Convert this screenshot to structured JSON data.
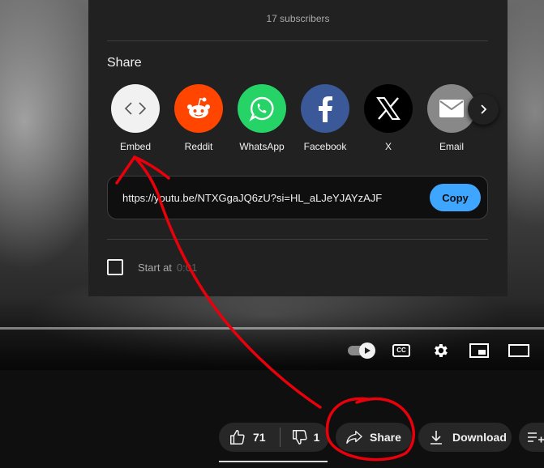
{
  "channel": {
    "subscribers": "17 subscribers"
  },
  "share_dialog": {
    "title": "Share",
    "targets": [
      {
        "label": "Embed",
        "icon": "embed-code-icon",
        "color": "#f1f1f1"
      },
      {
        "label": "Reddit",
        "icon": "reddit-icon",
        "color": "#ff4500"
      },
      {
        "label": "WhatsApp",
        "icon": "whatsapp-icon",
        "color": "#25d366"
      },
      {
        "label": "Facebook",
        "icon": "facebook-icon",
        "color": "#3b5998"
      },
      {
        "label": "X",
        "icon": "x-icon",
        "color": "#000000"
      },
      {
        "label": "Email",
        "icon": "email-icon",
        "color": "#888888"
      }
    ],
    "next_icon": "chevron-right-icon",
    "link": "https://youtu.be/NTXGgaJQ6zU?si=HL_aLJeYJAYzAJF",
    "copy_label": "Copy",
    "start_at_label": "Start at",
    "start_at_time": "0:01"
  },
  "player": {
    "controls": [
      "autoplay-toggle",
      "subtitles-cc",
      "settings",
      "miniplayer",
      "theater-mode"
    ]
  },
  "actions": {
    "like_count": "71",
    "dislike_count": "1",
    "share_label": "Share",
    "download_label": "Download"
  },
  "colors": {
    "annotation": "#e8000b",
    "accent": "#3ea6ff"
  }
}
